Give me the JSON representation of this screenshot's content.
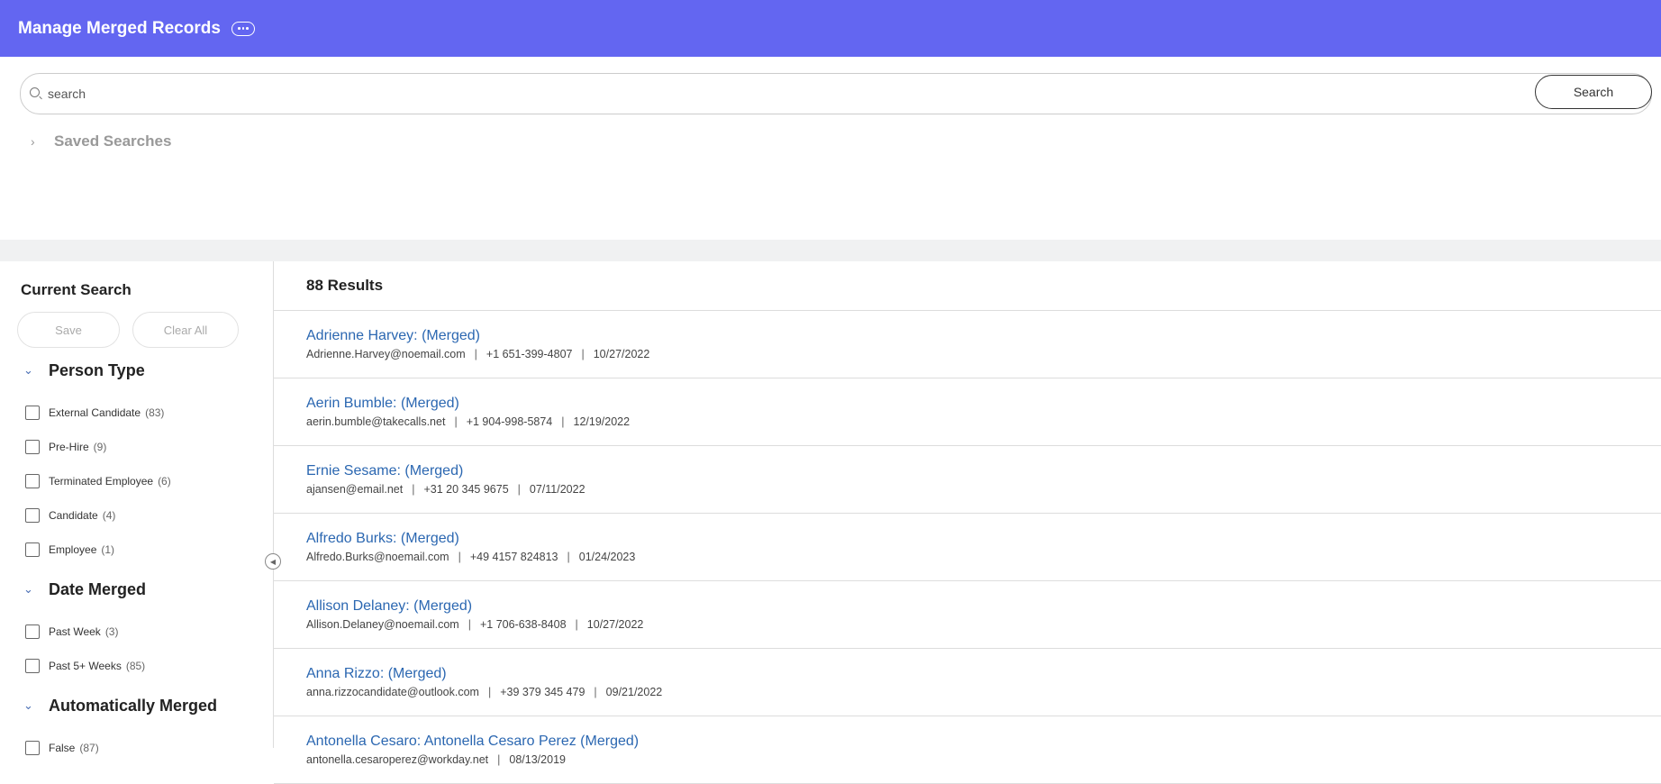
{
  "header": {
    "title": "Manage Merged Records"
  },
  "search": {
    "placeholder": "search",
    "button_label": "Search",
    "saved_searches_label": "Saved Searches"
  },
  "sidebar": {
    "title": "Current Search",
    "save_label": "Save",
    "clear_all_label": "Clear All",
    "facets": [
      {
        "title": "Person Type",
        "items": [
          {
            "label": "External Candidate",
            "count": "(83)"
          },
          {
            "label": "Pre-Hire",
            "count": "(9)"
          },
          {
            "label": "Terminated Employee",
            "count": "(6)"
          },
          {
            "label": "Candidate",
            "count": "(4)"
          },
          {
            "label": "Employee",
            "count": "(1)"
          }
        ]
      },
      {
        "title": "Date Merged",
        "items": [
          {
            "label": "Past Week",
            "count": "(3)"
          },
          {
            "label": "Past 5+ Weeks",
            "count": "(85)"
          }
        ]
      },
      {
        "title": "Automatically Merged",
        "items": [
          {
            "label": "False",
            "count": "(87)"
          }
        ]
      }
    ]
  },
  "results": {
    "count_label": "88 Results",
    "items": [
      {
        "name": "Adrienne Harvey: (Merged)",
        "email": "Adrienne.Harvey@noemail.com",
        "phone": "+1 651-399-4807",
        "date": "10/27/2022"
      },
      {
        "name": "Aerin Bumble: (Merged)",
        "email": "aerin.bumble@takecalls.net",
        "phone": "+1 904-998-5874",
        "date": "12/19/2022"
      },
      {
        "name": "Ernie Sesame: (Merged)",
        "email": "ajansen@email.net",
        "phone": "+31 20 345 9675",
        "date": "07/11/2022"
      },
      {
        "name": "Alfredo Burks: (Merged)",
        "email": "Alfredo.Burks@noemail.com",
        "phone": "+49 4157 824813",
        "date": "01/24/2023"
      },
      {
        "name": "Allison Delaney: (Merged)",
        "email": "Allison.Delaney@noemail.com",
        "phone": "+1 706-638-8408",
        "date": "10/27/2022"
      },
      {
        "name": "Anna Rizzo: (Merged)",
        "email": "anna.rizzocandidate@outlook.com",
        "phone": "+39 379 345 479",
        "date": "09/21/2022"
      },
      {
        "name": "Antonella Cesaro: Antonella Cesaro Perez (Merged)",
        "email": "antonella.cesaroperez@workday.net",
        "phone": "",
        "date": "08/13/2019"
      }
    ]
  },
  "colors": {
    "header_bg": "#6366f1",
    "link": "#2b67b1"
  }
}
